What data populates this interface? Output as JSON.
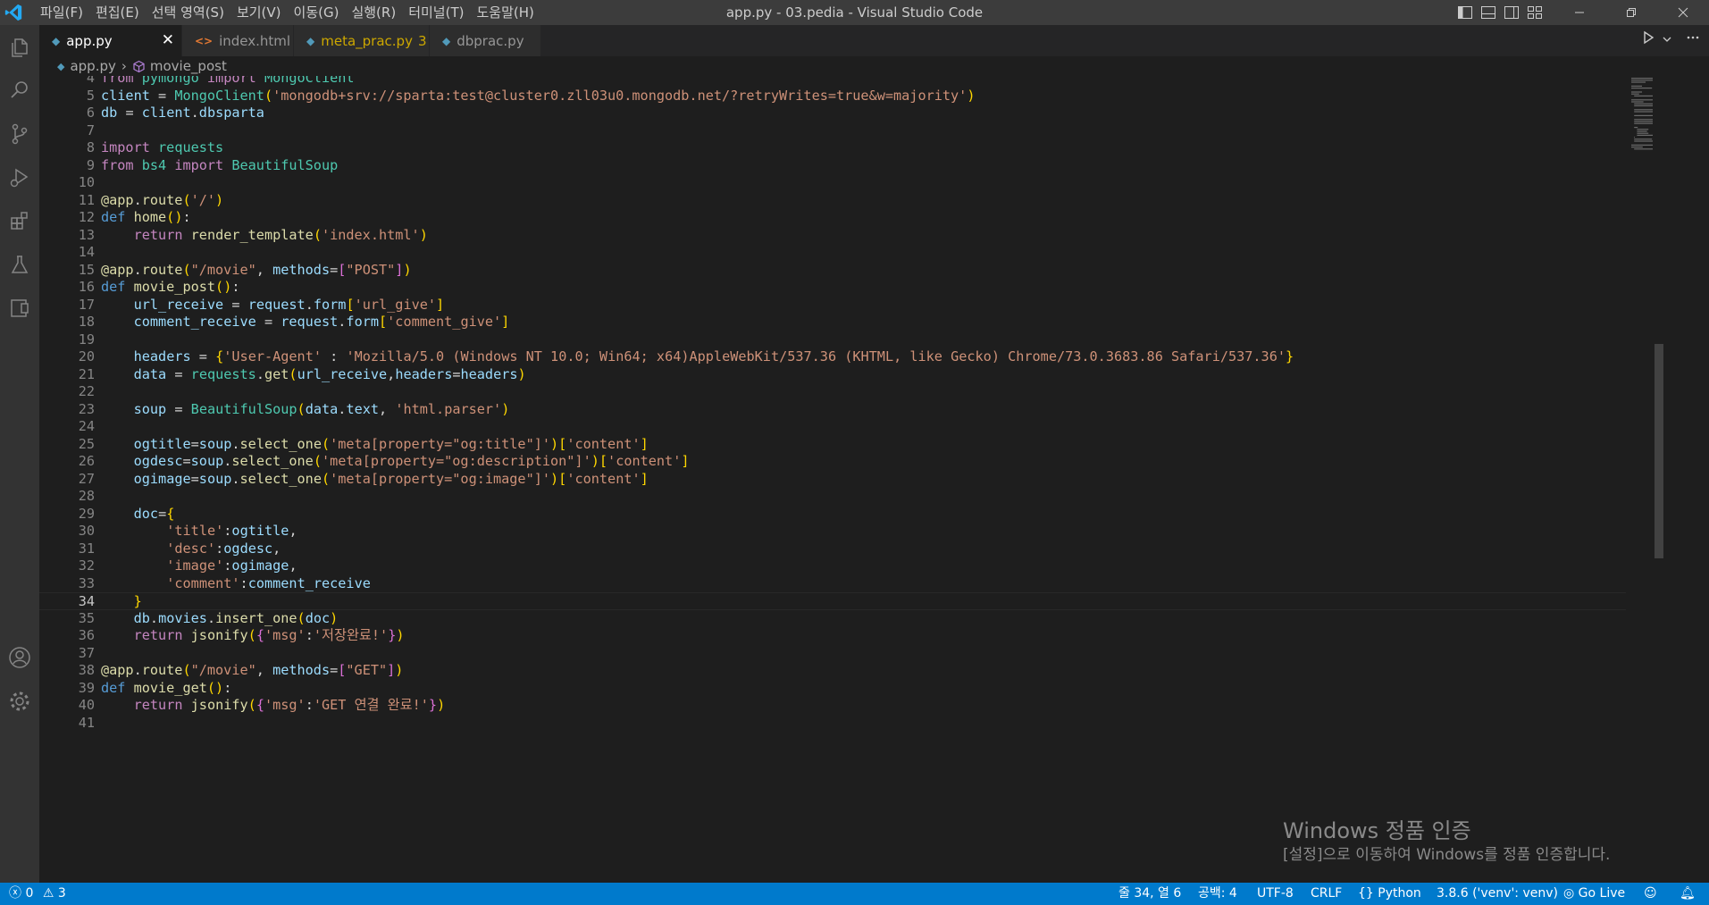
{
  "window": {
    "title": "app.py - 03.pedia - Visual Studio Code",
    "menu": [
      "파일(F)",
      "편집(E)",
      "선택 영역(S)",
      "보기(V)",
      "이동(G)",
      "실행(R)",
      "터미널(T)",
      "도움말(H)"
    ]
  },
  "activity_bar": [
    "files-icon",
    "search-icon",
    "source-control-icon",
    "run-debug-icon",
    "extensions-icon",
    "testing-icon",
    "remote-explorer-icon",
    "account-icon",
    "settings-gear-icon"
  ],
  "tabs": [
    {
      "label": "app.py",
      "active": true,
      "icon": "python-icon",
      "color": "#ffffff"
    },
    {
      "label": "index.html",
      "active": false,
      "icon": "html-icon",
      "color": "#969696"
    },
    {
      "label": "meta_prac.py",
      "badge": "3",
      "active": false,
      "icon": "python-icon",
      "color": "#cca700"
    },
    {
      "label": "dbprac.py",
      "active": false,
      "icon": "python-icon",
      "color": "#969696"
    }
  ],
  "breadcrumb": {
    "file": "app.py",
    "symbol": "movie_post"
  },
  "editor": {
    "current_line": 34,
    "lines": [
      {
        "n": 4,
        "t": "from pymongo import MongoClient"
      },
      {
        "n": 5,
        "t": "client = MongoClient('mongodb+srv://sparta:test@cluster0.zll03u0.mongodb.net/?retryWrites=true&w=majority')"
      },
      {
        "n": 6,
        "t": "db = client.dbsparta"
      },
      {
        "n": 7,
        "t": ""
      },
      {
        "n": 8,
        "t": "import requests"
      },
      {
        "n": 9,
        "t": "from bs4 import BeautifulSoup"
      },
      {
        "n": 10,
        "t": ""
      },
      {
        "n": 11,
        "t": "@app.route('/')"
      },
      {
        "n": 12,
        "t": "def home():"
      },
      {
        "n": 13,
        "t": "    return render_template('index.html')"
      },
      {
        "n": 14,
        "t": ""
      },
      {
        "n": 15,
        "t": "@app.route(\"/movie\", methods=[\"POST\"])"
      },
      {
        "n": 16,
        "t": "def movie_post():"
      },
      {
        "n": 17,
        "t": "    url_receive = request.form['url_give']"
      },
      {
        "n": 18,
        "t": "    comment_receive = request.form['comment_give']"
      },
      {
        "n": 19,
        "t": ""
      },
      {
        "n": 20,
        "t": "    headers = {'User-Agent' : 'Mozilla/5.0 (Windows NT 10.0; Win64; x64)AppleWebKit/537.36 (KHTML, like Gecko) Chrome/73.0.3683.86 Safari/537.36'}"
      },
      {
        "n": 21,
        "t": "    data = requests.get(url_receive,headers=headers)"
      },
      {
        "n": 22,
        "t": ""
      },
      {
        "n": 23,
        "t": "    soup = BeautifulSoup(data.text, 'html.parser')"
      },
      {
        "n": 24,
        "t": ""
      },
      {
        "n": 25,
        "t": "    ogtitle=soup.select_one('meta[property=\"og:title\"]')['content']"
      },
      {
        "n": 26,
        "t": "    ogdesc=soup.select_one('meta[property=\"og:description\"]')['content']"
      },
      {
        "n": 27,
        "t": "    ogimage=soup.select_one('meta[property=\"og:image\"]')['content']"
      },
      {
        "n": 28,
        "t": ""
      },
      {
        "n": 29,
        "t": "    doc={"
      },
      {
        "n": 30,
        "t": "        'title':ogtitle,"
      },
      {
        "n": 31,
        "t": "        'desc':ogdesc,"
      },
      {
        "n": 32,
        "t": "        'image':ogimage,"
      },
      {
        "n": 33,
        "t": "        'comment':comment_receive"
      },
      {
        "n": 34,
        "t": "    }"
      },
      {
        "n": 35,
        "t": "    db.movies.insert_one(doc)"
      },
      {
        "n": 36,
        "t": "    return jsonify({'msg':'저장완료!'})"
      },
      {
        "n": 37,
        "t": ""
      },
      {
        "n": 38,
        "t": "@app.route(\"/movie\", methods=[\"GET\"])"
      },
      {
        "n": 39,
        "t": "def movie_get():"
      },
      {
        "n": 40,
        "t": "    return jsonify({'msg':'GET 연결 완료!'})"
      },
      {
        "n": 41,
        "t": ""
      }
    ]
  },
  "watermark": {
    "title": "Windows 정품 인증",
    "subtitle": "[설정]으로 이동하여 Windows를 정품 인증합니다."
  },
  "status_bar": {
    "errors": "0",
    "warnings": "3",
    "position": "줄 34, 열 6",
    "spaces": "공백: 4",
    "encoding": "UTF-8",
    "eol": "CRLF",
    "language": "Python",
    "interpreter": "3.8.6 ('venv': venv)",
    "go_live": "Go Live"
  },
  "colors": {
    "accent": "#007acc",
    "editor_bg": "#1e1e1e",
    "titlebar_bg": "#3c3c3c",
    "activitybar_bg": "#333333",
    "tabbar_bg": "#252526"
  }
}
